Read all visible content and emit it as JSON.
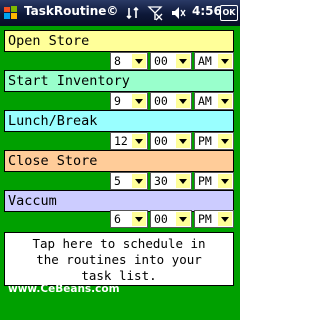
{
  "statusbar": {
    "title": "TaskRoutine©",
    "time": "4:56",
    "ok_label": "OK",
    "icons": [
      "windows-start-icon",
      "connectivity-icon",
      "signal-icon",
      "volume-icon"
    ]
  },
  "colors": {
    "content_bg": "#00a000",
    "dropdown_arrow_bg": "#ffff99",
    "task_colors": [
      "#ffff99",
      "#99ffcc",
      "#99ffff",
      "#ffcc99",
      "#ccccff"
    ]
  },
  "tasks": [
    {
      "label": "Open Store",
      "hour": "8",
      "minute": "00",
      "ampm": "AM"
    },
    {
      "label": "Start Inventory",
      "hour": "9",
      "minute": "00",
      "ampm": "AM"
    },
    {
      "label": "Lunch/Break",
      "hour": "12",
      "minute": "00",
      "ampm": "PM"
    },
    {
      "label": "Close Store",
      "hour": "5",
      "minute": "30",
      "ampm": "PM"
    },
    {
      "label": "Vaccum",
      "hour": "6",
      "minute": "00",
      "ampm": "PM"
    }
  ],
  "schedule_button": {
    "lines": [
      "Tap here to schedule in",
      "the routines into your",
      "task list."
    ]
  },
  "footer": {
    "link_text": "www.CeBeans.com"
  }
}
